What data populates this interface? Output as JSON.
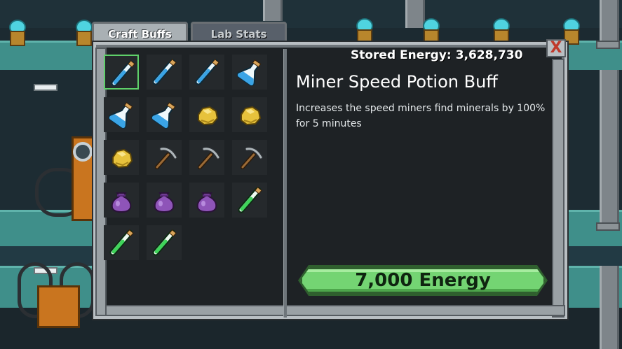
{
  "tabs": [
    {
      "label": "Craft Buffs",
      "active": true
    },
    {
      "label": "Lab Stats",
      "active": false
    }
  ],
  "stored_energy": {
    "label": "Stored Energy:",
    "value": "3,628,730"
  },
  "close_label": "X",
  "grid": {
    "selected_index": 0,
    "items": [
      {
        "icon": "blue-vial-icon"
      },
      {
        "icon": "blue-vial-icon"
      },
      {
        "icon": "blue-vial-icon"
      },
      {
        "icon": "blue-flask-icon"
      },
      {
        "icon": "blue-flask-icon"
      },
      {
        "icon": "blue-flask-icon"
      },
      {
        "icon": "gold-nugget-icon"
      },
      {
        "icon": "gold-nugget-icon"
      },
      {
        "icon": "gold-nugget-icon"
      },
      {
        "icon": "pickaxe-icon"
      },
      {
        "icon": "pickaxe-icon"
      },
      {
        "icon": "pickaxe-icon"
      },
      {
        "icon": "purple-bag-icon"
      },
      {
        "icon": "purple-bag-icon"
      },
      {
        "icon": "purple-bag-icon"
      },
      {
        "icon": "green-vial-icon"
      },
      {
        "icon": "green-vial-icon"
      },
      {
        "icon": "green-vial-icon"
      }
    ]
  },
  "detail": {
    "title": "Miner Speed Potion Buff",
    "description": "Increases the speed miners find minerals by 100% for 5 minutes",
    "cost_label": "7,000 Energy"
  },
  "colors": {
    "accent_green": "#74d473",
    "selection_green": "#5fd06a",
    "close_red": "#c0392b"
  }
}
